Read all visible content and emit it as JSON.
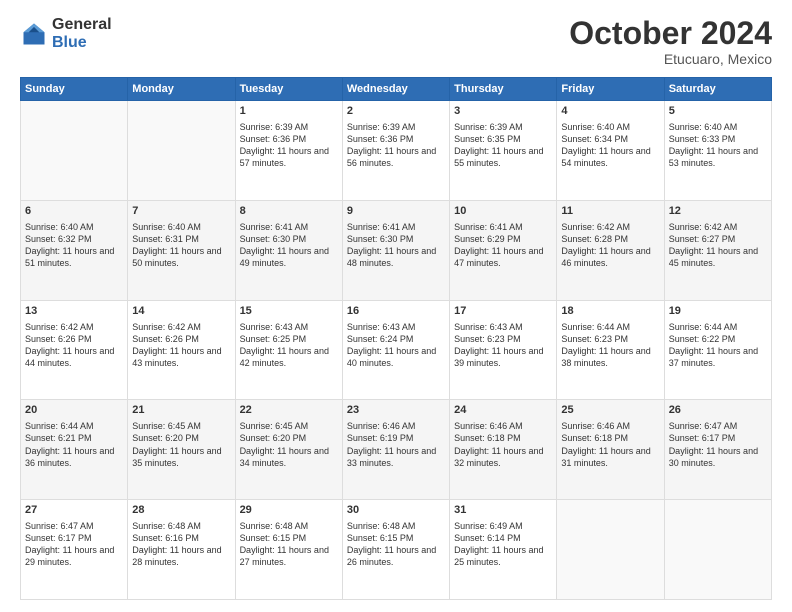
{
  "header": {
    "logo_general": "General",
    "logo_blue": "Blue",
    "month": "October 2024",
    "location": "Etucuaro, Mexico"
  },
  "weekdays": [
    "Sunday",
    "Monday",
    "Tuesday",
    "Wednesday",
    "Thursday",
    "Friday",
    "Saturday"
  ],
  "weeks": [
    [
      {
        "day": "",
        "sunrise": "",
        "sunset": "",
        "daylight": ""
      },
      {
        "day": "",
        "sunrise": "",
        "sunset": "",
        "daylight": ""
      },
      {
        "day": "1",
        "sunrise": "Sunrise: 6:39 AM",
        "sunset": "Sunset: 6:36 PM",
        "daylight": "Daylight: 11 hours and 57 minutes."
      },
      {
        "day": "2",
        "sunrise": "Sunrise: 6:39 AM",
        "sunset": "Sunset: 6:36 PM",
        "daylight": "Daylight: 11 hours and 56 minutes."
      },
      {
        "day": "3",
        "sunrise": "Sunrise: 6:39 AM",
        "sunset": "Sunset: 6:35 PM",
        "daylight": "Daylight: 11 hours and 55 minutes."
      },
      {
        "day": "4",
        "sunrise": "Sunrise: 6:40 AM",
        "sunset": "Sunset: 6:34 PM",
        "daylight": "Daylight: 11 hours and 54 minutes."
      },
      {
        "day": "5",
        "sunrise": "Sunrise: 6:40 AM",
        "sunset": "Sunset: 6:33 PM",
        "daylight": "Daylight: 11 hours and 53 minutes."
      }
    ],
    [
      {
        "day": "6",
        "sunrise": "Sunrise: 6:40 AM",
        "sunset": "Sunset: 6:32 PM",
        "daylight": "Daylight: 11 hours and 51 minutes."
      },
      {
        "day": "7",
        "sunrise": "Sunrise: 6:40 AM",
        "sunset": "Sunset: 6:31 PM",
        "daylight": "Daylight: 11 hours and 50 minutes."
      },
      {
        "day": "8",
        "sunrise": "Sunrise: 6:41 AM",
        "sunset": "Sunset: 6:30 PM",
        "daylight": "Daylight: 11 hours and 49 minutes."
      },
      {
        "day": "9",
        "sunrise": "Sunrise: 6:41 AM",
        "sunset": "Sunset: 6:30 PM",
        "daylight": "Daylight: 11 hours and 48 minutes."
      },
      {
        "day": "10",
        "sunrise": "Sunrise: 6:41 AM",
        "sunset": "Sunset: 6:29 PM",
        "daylight": "Daylight: 11 hours and 47 minutes."
      },
      {
        "day": "11",
        "sunrise": "Sunrise: 6:42 AM",
        "sunset": "Sunset: 6:28 PM",
        "daylight": "Daylight: 11 hours and 46 minutes."
      },
      {
        "day": "12",
        "sunrise": "Sunrise: 6:42 AM",
        "sunset": "Sunset: 6:27 PM",
        "daylight": "Daylight: 11 hours and 45 minutes."
      }
    ],
    [
      {
        "day": "13",
        "sunrise": "Sunrise: 6:42 AM",
        "sunset": "Sunset: 6:26 PM",
        "daylight": "Daylight: 11 hours and 44 minutes."
      },
      {
        "day": "14",
        "sunrise": "Sunrise: 6:42 AM",
        "sunset": "Sunset: 6:26 PM",
        "daylight": "Daylight: 11 hours and 43 minutes."
      },
      {
        "day": "15",
        "sunrise": "Sunrise: 6:43 AM",
        "sunset": "Sunset: 6:25 PM",
        "daylight": "Daylight: 11 hours and 42 minutes."
      },
      {
        "day": "16",
        "sunrise": "Sunrise: 6:43 AM",
        "sunset": "Sunset: 6:24 PM",
        "daylight": "Daylight: 11 hours and 40 minutes."
      },
      {
        "day": "17",
        "sunrise": "Sunrise: 6:43 AM",
        "sunset": "Sunset: 6:23 PM",
        "daylight": "Daylight: 11 hours and 39 minutes."
      },
      {
        "day": "18",
        "sunrise": "Sunrise: 6:44 AM",
        "sunset": "Sunset: 6:23 PM",
        "daylight": "Daylight: 11 hours and 38 minutes."
      },
      {
        "day": "19",
        "sunrise": "Sunrise: 6:44 AM",
        "sunset": "Sunset: 6:22 PM",
        "daylight": "Daylight: 11 hours and 37 minutes."
      }
    ],
    [
      {
        "day": "20",
        "sunrise": "Sunrise: 6:44 AM",
        "sunset": "Sunset: 6:21 PM",
        "daylight": "Daylight: 11 hours and 36 minutes."
      },
      {
        "day": "21",
        "sunrise": "Sunrise: 6:45 AM",
        "sunset": "Sunset: 6:20 PM",
        "daylight": "Daylight: 11 hours and 35 minutes."
      },
      {
        "day": "22",
        "sunrise": "Sunrise: 6:45 AM",
        "sunset": "Sunset: 6:20 PM",
        "daylight": "Daylight: 11 hours and 34 minutes."
      },
      {
        "day": "23",
        "sunrise": "Sunrise: 6:46 AM",
        "sunset": "Sunset: 6:19 PM",
        "daylight": "Daylight: 11 hours and 33 minutes."
      },
      {
        "day": "24",
        "sunrise": "Sunrise: 6:46 AM",
        "sunset": "Sunset: 6:18 PM",
        "daylight": "Daylight: 11 hours and 32 minutes."
      },
      {
        "day": "25",
        "sunrise": "Sunrise: 6:46 AM",
        "sunset": "Sunset: 6:18 PM",
        "daylight": "Daylight: 11 hours and 31 minutes."
      },
      {
        "day": "26",
        "sunrise": "Sunrise: 6:47 AM",
        "sunset": "Sunset: 6:17 PM",
        "daylight": "Daylight: 11 hours and 30 minutes."
      }
    ],
    [
      {
        "day": "27",
        "sunrise": "Sunrise: 6:47 AM",
        "sunset": "Sunset: 6:17 PM",
        "daylight": "Daylight: 11 hours and 29 minutes."
      },
      {
        "day": "28",
        "sunrise": "Sunrise: 6:48 AM",
        "sunset": "Sunset: 6:16 PM",
        "daylight": "Daylight: 11 hours and 28 minutes."
      },
      {
        "day": "29",
        "sunrise": "Sunrise: 6:48 AM",
        "sunset": "Sunset: 6:15 PM",
        "daylight": "Daylight: 11 hours and 27 minutes."
      },
      {
        "day": "30",
        "sunrise": "Sunrise: 6:48 AM",
        "sunset": "Sunset: 6:15 PM",
        "daylight": "Daylight: 11 hours and 26 minutes."
      },
      {
        "day": "31",
        "sunrise": "Sunrise: 6:49 AM",
        "sunset": "Sunset: 6:14 PM",
        "daylight": "Daylight: 11 hours and 25 minutes."
      },
      {
        "day": "",
        "sunrise": "",
        "sunset": "",
        "daylight": ""
      },
      {
        "day": "",
        "sunrise": "",
        "sunset": "",
        "daylight": ""
      }
    ]
  ]
}
